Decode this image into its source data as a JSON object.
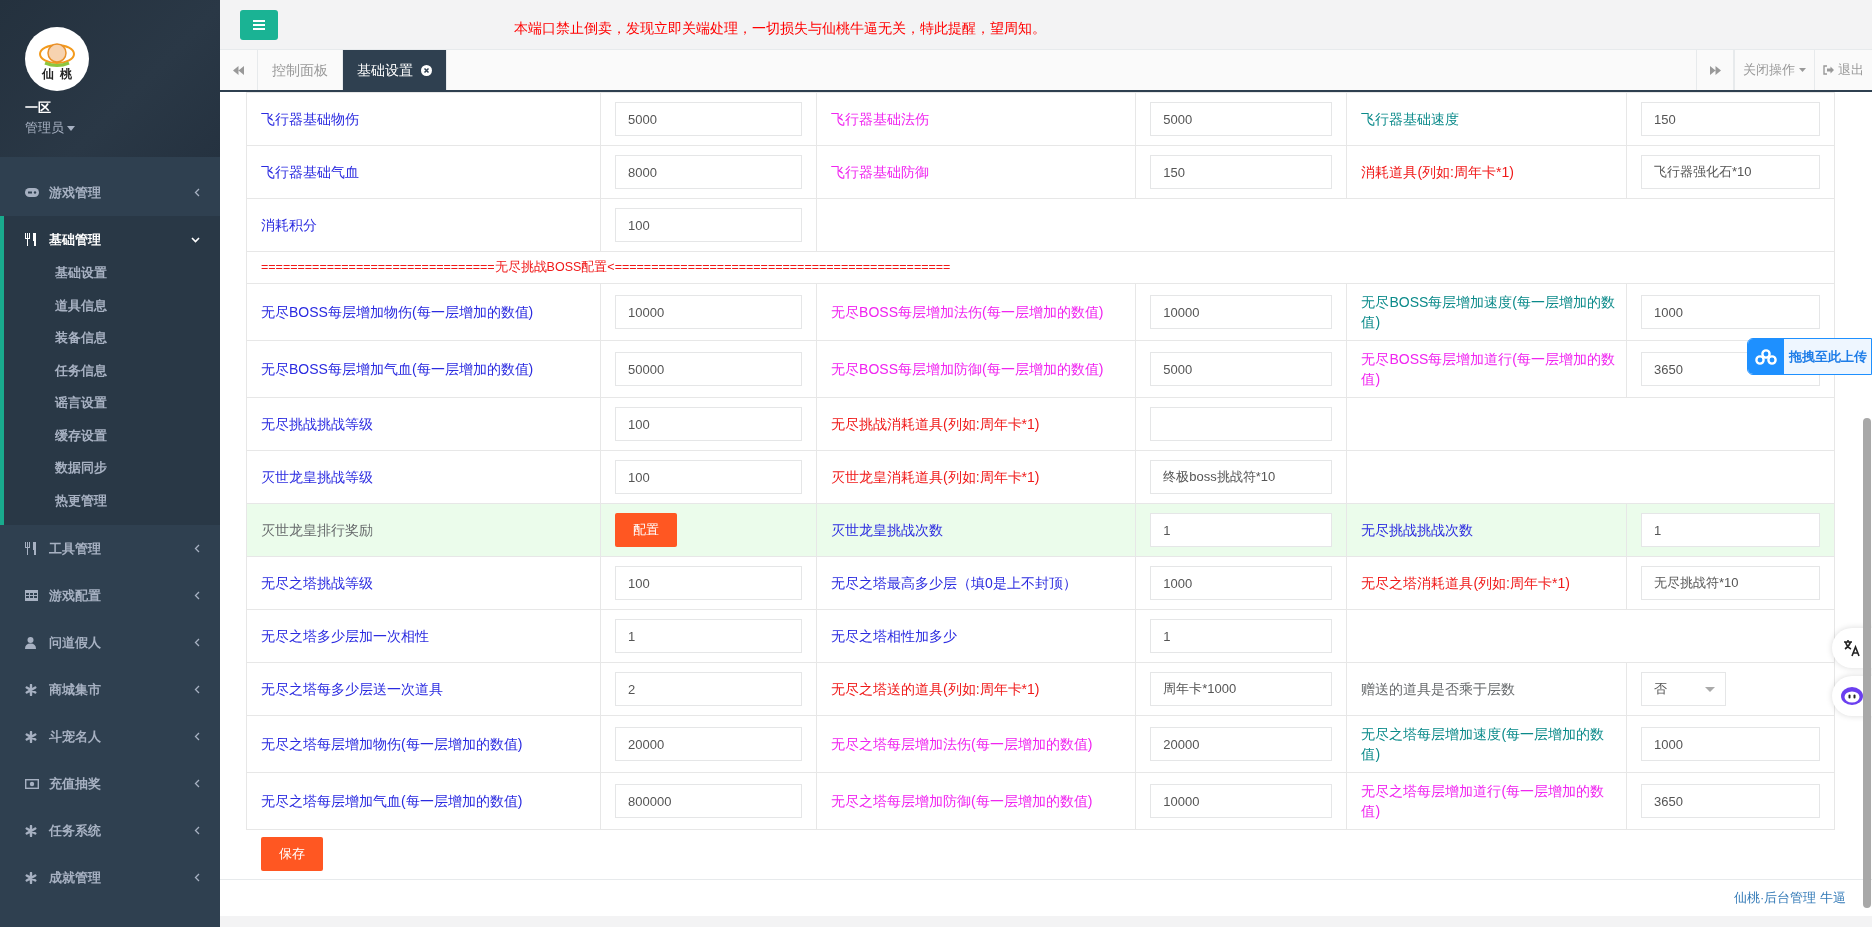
{
  "sidebar": {
    "logo_text": "仙桃",
    "server": "一区",
    "role": "管理员",
    "items": [
      {
        "label": "游戏管理",
        "expanded": false
      },
      {
        "label": "基础管理",
        "expanded": true,
        "children": [
          {
            "label": "基础设置"
          },
          {
            "label": "道具信息"
          },
          {
            "label": "装备信息"
          },
          {
            "label": "任务信息"
          },
          {
            "label": "谣言设置"
          },
          {
            "label": "缓存设置"
          },
          {
            "label": "数据同步"
          },
          {
            "label": "热更管理"
          }
        ]
      },
      {
        "label": "工具管理",
        "expanded": false
      },
      {
        "label": "游戏配置",
        "expanded": false
      },
      {
        "label": "问道假人",
        "expanded": false
      },
      {
        "label": "商城集市",
        "expanded": false
      },
      {
        "label": "斗宠名人",
        "expanded": false
      },
      {
        "label": "充值抽奖",
        "expanded": false
      },
      {
        "label": "任务系统",
        "expanded": false
      },
      {
        "label": "成就管理",
        "expanded": false
      }
    ]
  },
  "top_bar": {
    "notice": "本端口禁止倒卖，发现立即关端处理，一切损失与仙桃牛逼无关，特此提醒，望周知。"
  },
  "tabs": [
    {
      "label": "控制面板",
      "selected": false,
      "closable": false
    },
    {
      "label": "基础设置",
      "selected": true,
      "closable": true
    }
  ],
  "tab_actions": {
    "close_menu": "关闭操作",
    "logout": "退出"
  },
  "form": {
    "rows": [
      {
        "kind": "fields",
        "highlighted": false,
        "pairs": [
          {
            "label": "飞行器基础物伤",
            "color": "#2b2be0",
            "field": {
              "kind": "input",
              "value": "5000"
            }
          },
          {
            "label": "飞行器基础法伤",
            "color": "#f024f0",
            "field": {
              "kind": "input",
              "value": "5000"
            }
          },
          {
            "label": "飞行器基础速度",
            "color": "#0b8a8a",
            "field": {
              "kind": "input",
              "value": "150"
            }
          }
        ]
      },
      {
        "kind": "fields",
        "highlighted": false,
        "pairs": [
          {
            "label": "飞行器基础气血",
            "color": "#2b2be0",
            "field": {
              "kind": "input",
              "value": "8000"
            }
          },
          {
            "label": "飞行器基础防御",
            "color": "#f024f0",
            "field": {
              "kind": "input",
              "value": "150"
            }
          },
          {
            "label": "消耗道具(列如:周年卡*1)",
            "color": "#f01818",
            "field": {
              "kind": "input",
              "value": "飞行器强化石*10"
            }
          }
        ]
      },
      {
        "kind": "fields",
        "highlighted": false,
        "pairs": [
          {
            "label": "消耗积分",
            "color": "#2b2be0",
            "field": {
              "kind": "input",
              "value": "100"
            }
          }
        ]
      },
      {
        "kind": "separator",
        "text": "================================无尽挑战BOSS配置<=============================================="
      },
      {
        "kind": "fields",
        "highlighted": false,
        "pairs": [
          {
            "label": "无尽BOSS每层增加物伤(每一层增加的数值)",
            "color": "#2b2be0",
            "field": {
              "kind": "input",
              "value": "10000"
            }
          },
          {
            "label": "无尽BOSS每层增加法伤(每一层增加的数值)",
            "color": "#f024f0",
            "field": {
              "kind": "input",
              "value": "10000"
            }
          },
          {
            "label": "无尽BOSS每层增加速度(每一层增加的数值)",
            "color": "#0b8a8a",
            "field": {
              "kind": "input",
              "value": "1000"
            }
          }
        ]
      },
      {
        "kind": "fields",
        "highlighted": false,
        "pairs": [
          {
            "label": "无尽BOSS每层增加气血(每一层增加的数值)",
            "color": "#2b2be0",
            "field": {
              "kind": "input",
              "value": "50000"
            }
          },
          {
            "label": "无尽BOSS每层增加防御(每一层增加的数值)",
            "color": "#f024f0",
            "field": {
              "kind": "input",
              "value": "5000"
            }
          },
          {
            "label": "无尽BOSS每层增加道行(每一层增加的数值)",
            "color": "#f024f0",
            "field": {
              "kind": "input",
              "value": "3650"
            }
          }
        ]
      },
      {
        "kind": "fields",
        "highlighted": false,
        "pairs": [
          {
            "label": "无尽挑战挑战等级",
            "color": "#2b2be0",
            "field": {
              "kind": "input",
              "value": "100"
            }
          },
          {
            "label": "无尽挑战消耗道具(列如:周年卡*1)",
            "color": "#f01818",
            "field": {
              "kind": "input"
            }
          }
        ]
      },
      {
        "kind": "fields",
        "highlighted": false,
        "pairs": [
          {
            "label": "灭世龙皇挑战等级",
            "color": "#2b2be0",
            "field": {
              "kind": "input",
              "value": "100"
            }
          },
          {
            "label": "灭世龙皇消耗道具(列如:周年卡*1)",
            "color": "#f01818",
            "field": {
              "kind": "input",
              "value": "终极boss挑战符*10"
            }
          }
        ]
      },
      {
        "kind": "fields",
        "highlighted": true,
        "pairs": [
          {
            "label": "灭世龙皇排行奖励",
            "color": "#676a6c",
            "field": {
              "kind": "button",
              "label": "配置"
            }
          },
          {
            "label": "灭世龙皇挑战次数",
            "color": "#2b2be0",
            "field": {
              "kind": "input",
              "value": "1"
            }
          },
          {
            "label": "无尽挑战挑战次数",
            "color": "#2b2be0",
            "field": {
              "kind": "input",
              "value": "1"
            }
          }
        ]
      },
      {
        "kind": "fields",
        "highlighted": false,
        "pairs": [
          {
            "label": "无尽之塔挑战等级",
            "color": "#2b2be0",
            "field": {
              "kind": "input",
              "value": "100"
            }
          },
          {
            "label": "无尽之塔最高多少层（填0是上不封顶）",
            "color": "#2b2be0",
            "field": {
              "kind": "input",
              "value": "1000"
            }
          },
          {
            "label": "无尽之塔消耗道具(列如:周年卡*1)",
            "color": "#f01818",
            "field": {
              "kind": "input",
              "value": "无尽挑战符*10"
            }
          }
        ]
      },
      {
        "kind": "fields",
        "highlighted": false,
        "pairs": [
          {
            "label": "无尽之塔多少层加一次相性",
            "color": "#2b2be0",
            "field": {
              "kind": "input",
              "value": "1"
            }
          },
          {
            "label": "无尽之塔相性加多少",
            "color": "#2b2be0",
            "field": {
              "kind": "input",
              "value": "1"
            }
          }
        ]
      },
      {
        "kind": "fields",
        "highlighted": false,
        "pairs": [
          {
            "label": "无尽之塔每多少层送一次道具",
            "color": "#2b2be0",
            "field": {
              "kind": "input",
              "value": "2"
            }
          },
          {
            "label": "无尽之塔送的道具(列如:周年卡*1)",
            "color": "#f01818",
            "field": {
              "kind": "input",
              "value": "周年卡*1000"
            }
          },
          {
            "label": "赠送的道具是否乘于层数",
            "color": "#676a6c",
            "field": {
              "kind": "select",
              "value": "否"
            }
          }
        ]
      },
      {
        "kind": "fields",
        "highlighted": false,
        "pairs": [
          {
            "label": "无尽之塔每层增加物伤(每一层增加的数值)",
            "color": "#2b2be0",
            "field": {
              "kind": "input",
              "value": "20000"
            }
          },
          {
            "label": "无尽之塔每层增加法伤(每一层增加的数值)",
            "color": "#f024f0",
            "field": {
              "kind": "input",
              "value": "20000"
            }
          },
          {
            "label": "无尽之塔每层增加速度(每一层增加的数值)",
            "color": "#0b8a8a",
            "field": {
              "kind": "input",
              "value": "1000"
            }
          }
        ]
      },
      {
        "kind": "fields",
        "highlighted": false,
        "pairs": [
          {
            "label": "无尽之塔每层增加气血(每一层增加的数值)",
            "color": "#2b2be0",
            "field": {
              "kind": "input",
              "value": "800000"
            }
          },
          {
            "label": "无尽之塔每层增加防御(每一层增加的数值)",
            "color": "#f024f0",
            "field": {
              "kind": "input",
              "value": "10000"
            }
          },
          {
            "label": "无尽之塔每层增加道行(每一层增加的数值)",
            "color": "#f024f0",
            "field": {
              "kind": "input",
              "value": "3650"
            }
          }
        ]
      }
    ],
    "save_button": "保存"
  },
  "footer": {
    "text": "仙桃·后台管理 牛逼"
  },
  "upload_badge": {
    "label": "拖拽至此上传"
  }
}
